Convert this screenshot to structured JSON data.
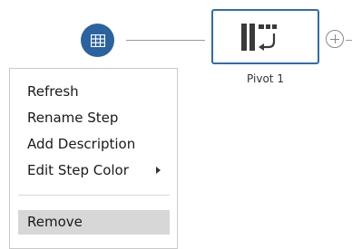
{
  "flow": {
    "input_node": {
      "icon": "table-grid-icon",
      "color": "#2b62a0"
    },
    "pivot_node": {
      "label": "Pivot 1",
      "icon": "pivot-icon",
      "border_color": "#2f6bb3"
    },
    "add_node": {
      "icon": "plus-circle-icon"
    }
  },
  "context_menu": {
    "items": [
      {
        "label": "Refresh"
      },
      {
        "label": "Rename Step"
      },
      {
        "label": "Add Description"
      },
      {
        "label": "Edit Step Color",
        "has_submenu": true
      }
    ],
    "remove_label": "Remove",
    "highlight_color": "#d7d7d7"
  }
}
